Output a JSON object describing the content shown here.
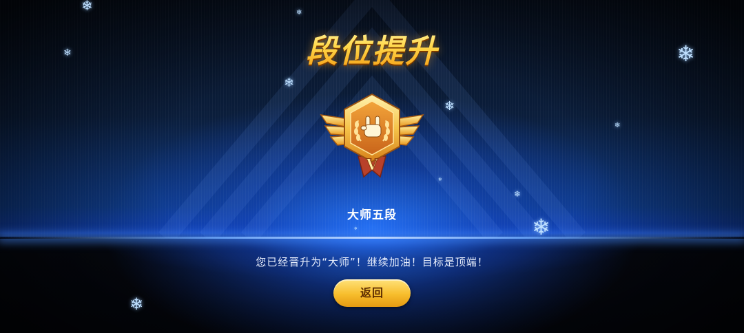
{
  "screen": {
    "title": "段位提升",
    "rank_name": "大师五段",
    "message": "您已经晋升为“大师”！继续加油！目标是顶端！",
    "back_label": "返回"
  },
  "badge": {
    "tier_numeral": "V",
    "emblem_icon": "rock-hand-icon"
  },
  "decorations": {
    "snowflake_glyph": "❄"
  },
  "colors": {
    "title_gold": "#ffd23d",
    "button_gold": "#f7bd2c",
    "stage_blue": "#1242b8"
  }
}
